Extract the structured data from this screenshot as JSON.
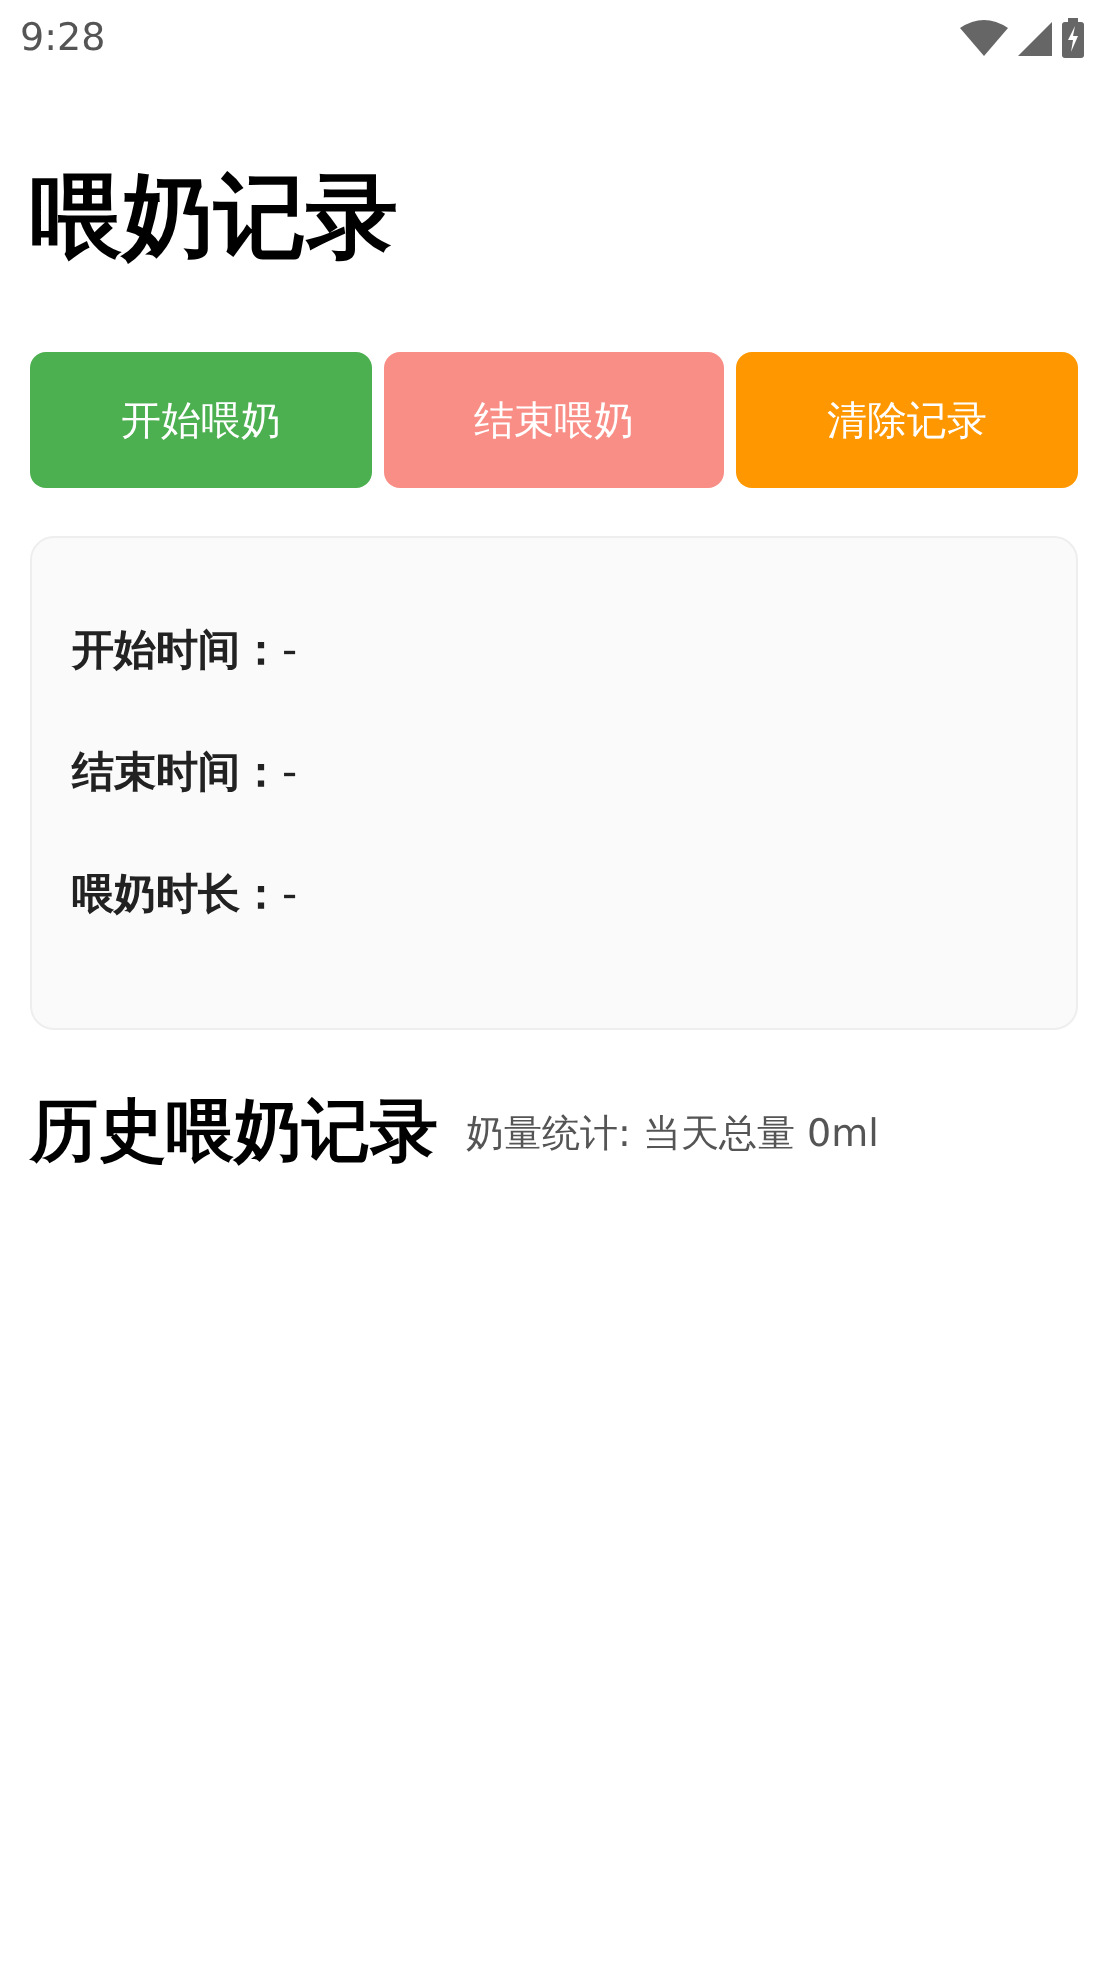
{
  "status_bar": {
    "time": "9:28"
  },
  "title": "喂奶记录",
  "buttons": [
    {
      "label": "开始喂奶",
      "color": "#4caf50"
    },
    {
      "label": "结束喂奶",
      "color": "#f88e86"
    },
    {
      "label": "清除记录",
      "color": "#ff9800"
    }
  ],
  "card": {
    "rows": [
      "**开始时间：**-",
      "**结束时间：**-",
      "**喂奶时长：**-"
    ]
  },
  "history": {
    "title": "历史喂奶记录",
    "stats": "奶量统计: 当天总量 0ml"
  }
}
